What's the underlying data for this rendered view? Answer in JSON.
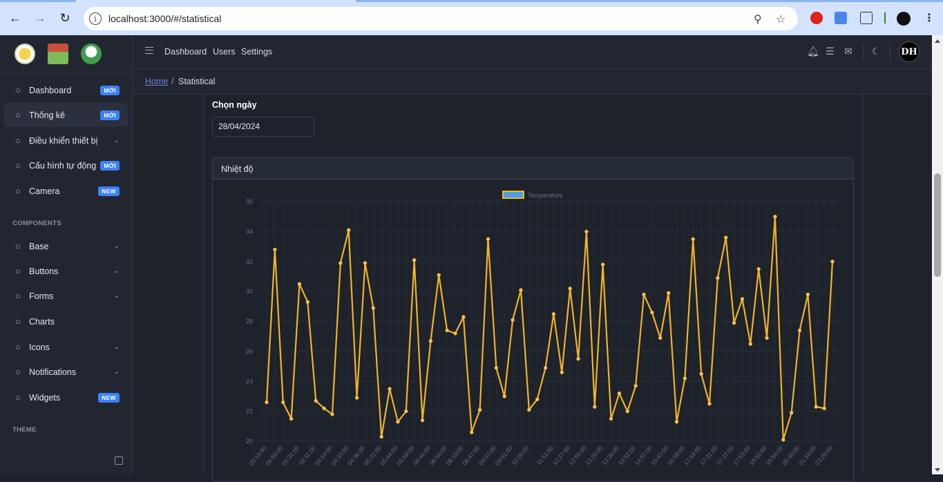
{
  "browser": {
    "url": "localhost:3000/#/statistical",
    "accent": "#d3e3fd"
  },
  "sidebar": {
    "items": [
      {
        "label": "Dashboard",
        "badge": "MỚI",
        "icon": "speedometer-icon"
      },
      {
        "label": "Thống kê",
        "badge": "MỚI",
        "icon": "chart-clock-icon"
      },
      {
        "label": "Điều khiển thiết bị",
        "chevron": true,
        "icon": "devices-icon"
      },
      {
        "label": "Cấu hình tự động",
        "badge": "MỚI",
        "icon": "gear-icon"
      },
      {
        "label": "Camera",
        "badge": "NEW",
        "icon": "camera-icon"
      }
    ],
    "section_components": "COMPONENTS",
    "components": [
      {
        "label": "Base",
        "chevron": true,
        "icon": "puzzle-icon"
      },
      {
        "label": "Buttons",
        "chevron": true,
        "icon": "cursor-icon"
      },
      {
        "label": "Forms",
        "chevron": true,
        "icon": "notes-icon"
      },
      {
        "label": "Charts",
        "icon": "chart-pie-icon"
      },
      {
        "label": "Icons",
        "chevron": true,
        "icon": "star-icon"
      },
      {
        "label": "Notifications",
        "chevron": true,
        "icon": "bell-icon"
      },
      {
        "label": "Widgets",
        "badge": "NEW",
        "icon": "calculator-icon"
      }
    ],
    "section_theme": "THEME"
  },
  "header": {
    "links": [
      "Dashboard",
      "Users",
      "Settings"
    ],
    "avatar_text": "DH"
  },
  "breadcrumb": {
    "home": "Home",
    "separator": "/",
    "current": "Statistical"
  },
  "filter": {
    "label": "Chọn ngày",
    "date_value": "28/04/2024"
  },
  "card": {
    "title": "Nhiệt độ"
  },
  "colors": {
    "line": "#f0b429",
    "legend_fill": "#4b9fe8",
    "badge": "#3b82f6"
  },
  "chart_data": {
    "type": "line",
    "title": "",
    "xlabel": "",
    "ylabel": "",
    "ylim": [
      20,
      36
    ],
    "yticks": [
      20,
      22,
      24,
      26,
      28,
      30,
      32,
      34,
      36
    ],
    "legend": "top-center",
    "grid": true,
    "series": [
      {
        "name": "Temperature",
        "values": [
          22.6,
          32.8,
          22.6,
          21.5,
          30.5,
          29.3,
          22.7,
          22.2,
          21.8,
          31.9,
          34.1,
          22.9,
          31.9,
          28.9,
          20.3,
          23.5,
          21.3,
          22.0,
          32.1,
          21.4,
          26.7,
          31.1,
          27.4,
          27.2,
          28.3,
          20.6,
          22.1,
          33.5,
          24.9,
          23.0,
          28.1,
          30.1,
          22.1,
          22.8,
          24.9,
          28.5,
          24.6,
          30.2,
          25.5,
          34.0,
          22.3,
          31.8,
          21.5,
          23.2,
          22.0,
          23.7,
          29.8,
          28.6,
          26.9,
          29.9,
          21.3,
          24.2,
          33.5,
          24.5,
          22.5,
          30.9,
          33.6,
          27.9,
          29.5,
          26.5,
          31.5,
          26.9,
          35.0,
          20.1,
          21.9,
          27.4,
          29.8,
          22.3,
          22.2,
          32.0
        ]
      }
    ],
    "x_tick_labels": [
      "00:19:00",
      "00:50:00",
      "01:31:00",
      "02:11:00",
      "04:14:00",
      "04:33:00",
      "04:36:00",
      "05:22:00",
      "05:44:00",
      "05:59:00",
      "06:44:00",
      "06:54:00",
      "08:15:00",
      "08:47:00",
      "09:07:00",
      "09:51:00",
      "10:26:00",
      "11:51:00",
      "12:27:00",
      "12:56:00",
      "13:20:00",
      "13:36:00",
      "13:52:00",
      "14:57:00",
      "15:43:00",
      "16:58:00",
      "17:19:00",
      "17:31:00",
      "17:37:00",
      "17:53:00",
      "19:10:00",
      "19:54:00",
      "20:45:00",
      "21:14:00",
      "23:29:00"
    ]
  }
}
